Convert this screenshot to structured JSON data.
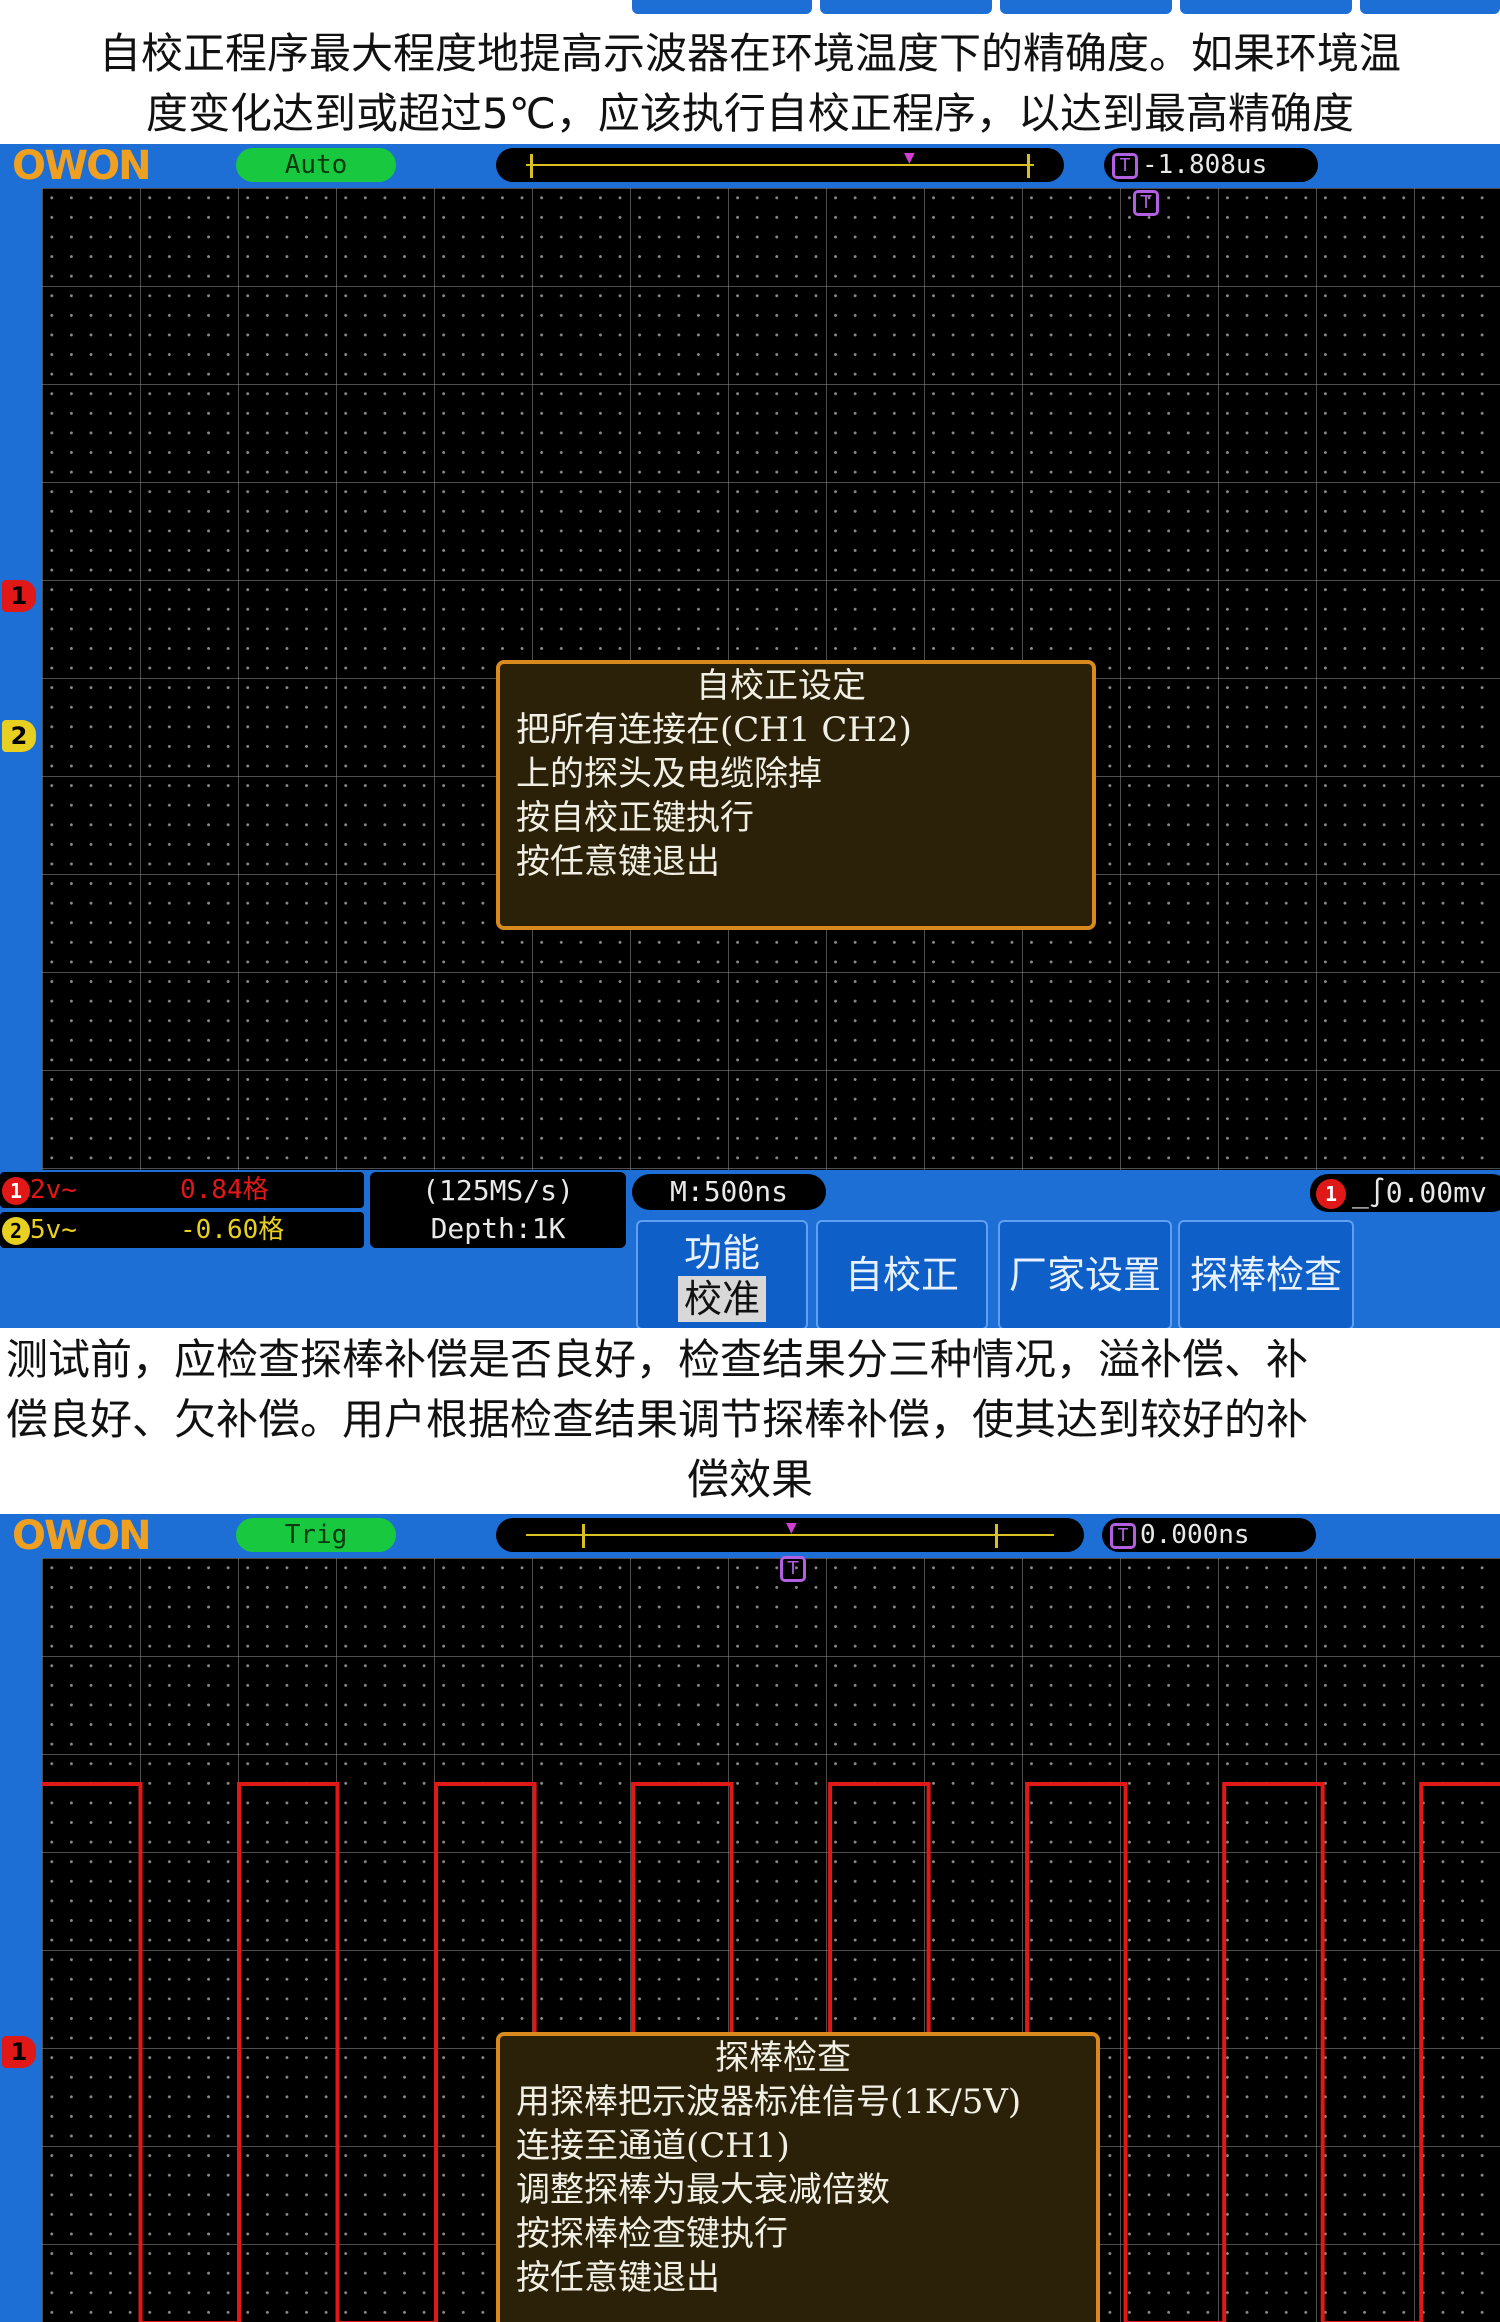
{
  "caption1": {
    "line1": "自校正程序最大程度地提高示波器在环境温度下的精确度。如果环境温",
    "line2": "度变化达到或超过5℃，应该执行自校正程序，以达到最高精确度"
  },
  "caption2": {
    "line1": "测试前，应检查探棒补偿是否良好，检查结果分三种情况，溢补偿、补",
    "line2": "偿良好、欠补偿。用户根据检查结果调节探棒补偿，使其达到较好的补",
    "line3": "偿效果"
  },
  "scope1": {
    "logo": "OWON",
    "mode": "Auto",
    "trigger_position": "-1.808us",
    "trigger_icon": "T",
    "dialog": {
      "title": "自校正设定",
      "lines": [
        "把所有连接在(CH1 CH2)",
        "上的探头及电缆除掉",
        "按自校正键执行",
        "按任意键退出"
      ]
    },
    "ch1": {
      "marker": "1",
      "label": "2v~",
      "offset": "0.84格",
      "color": "#e01818"
    },
    "ch2": {
      "marker": "2",
      "label": "5v~",
      "offset": "-0.60格",
      "color": "#e8d020"
    },
    "sample_rate": "(125MS/s)",
    "depth": "Depth:1K",
    "timebase": "M:500ns",
    "trigger": {
      "channel": "1",
      "level": "0.00mv"
    },
    "menu": {
      "function_label": "功能",
      "function_value": "校准",
      "self_cal": "自校正",
      "factory": "厂家设置",
      "probe_check": "探棒检查"
    }
  },
  "scope2": {
    "logo": "OWON",
    "mode": "Trig",
    "trigger_position": "0.000ns",
    "trigger_icon": "T",
    "ch1_marker": "1",
    "dialog": {
      "title": "探棒检查",
      "lines": [
        "用探棒把示波器标准信号(1K/5V)",
        "连接至通道(CH1)",
        "调整探棒为最大衰减倍数",
        "按探棒检查键执行",
        "按任意键退出"
      ]
    },
    "signal": {
      "type": "square",
      "periods_visible": 7.4,
      "high_div": 3.0,
      "low_div": -2.5,
      "color": "#e01818"
    }
  }
}
